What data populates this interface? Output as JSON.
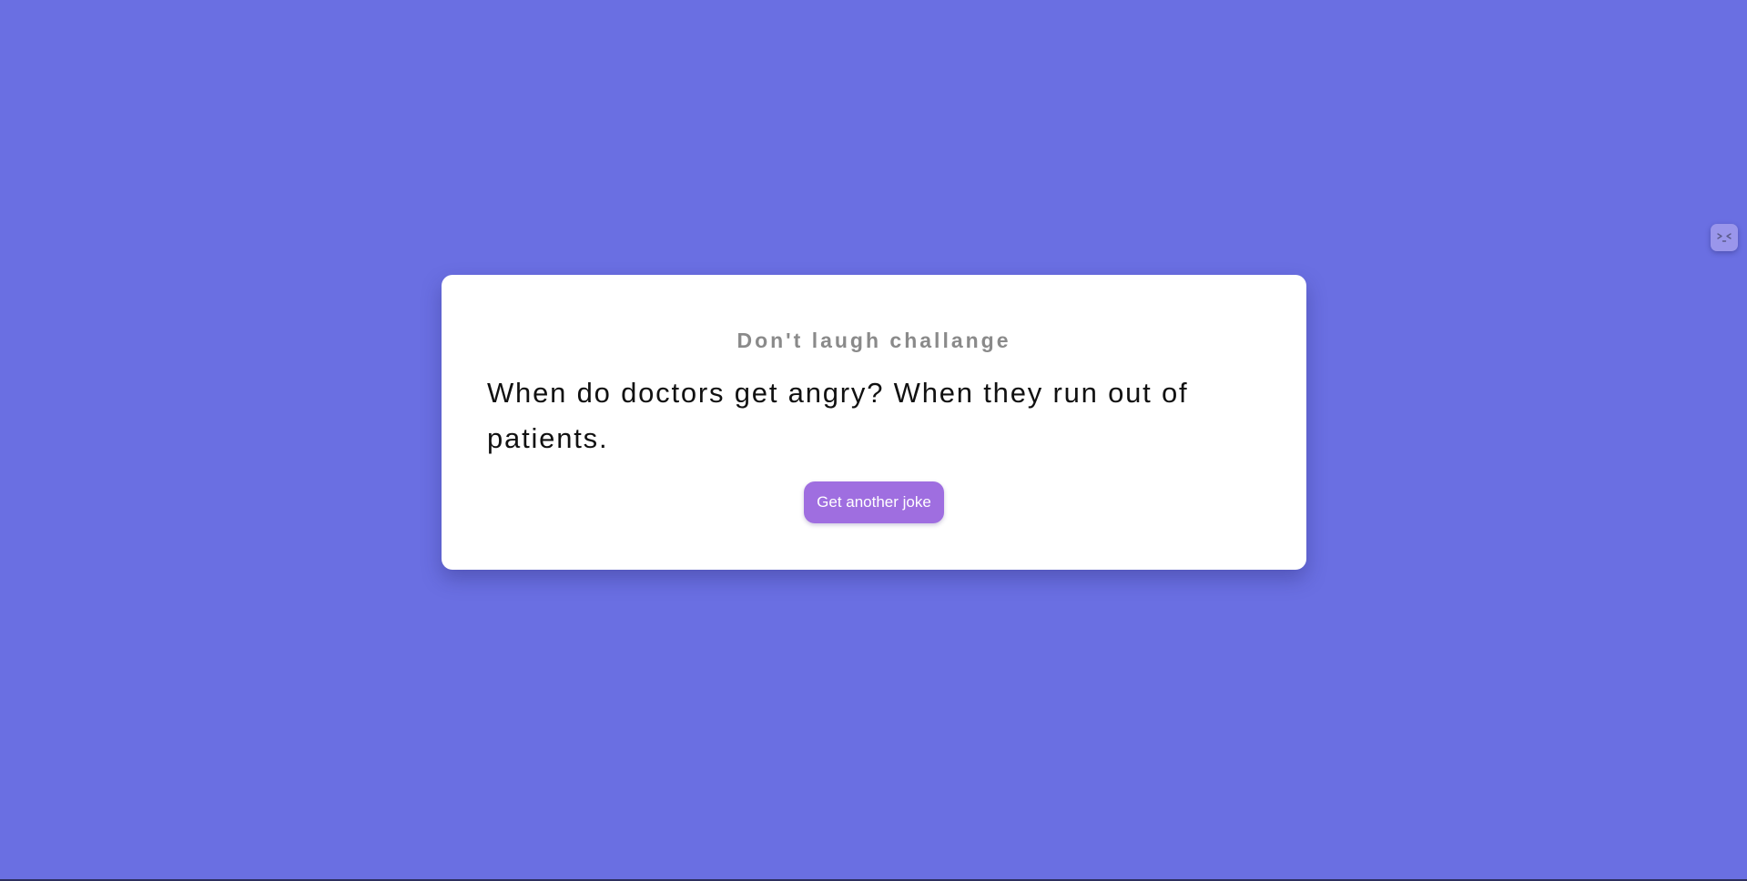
{
  "card": {
    "title": "Don't laugh challange",
    "joke": "When do doctors get angry? When they run out of patients.",
    "button_label": "Get another joke"
  },
  "extension_widget": {
    "icon": "squinting-face-icon"
  },
  "colors": {
    "background": "#6a6fe2",
    "card": "#ffffff",
    "title": "#8a8a8a",
    "joke_text": "#111111",
    "button": "#9f6ee0",
    "button_text": "#ffffff"
  }
}
